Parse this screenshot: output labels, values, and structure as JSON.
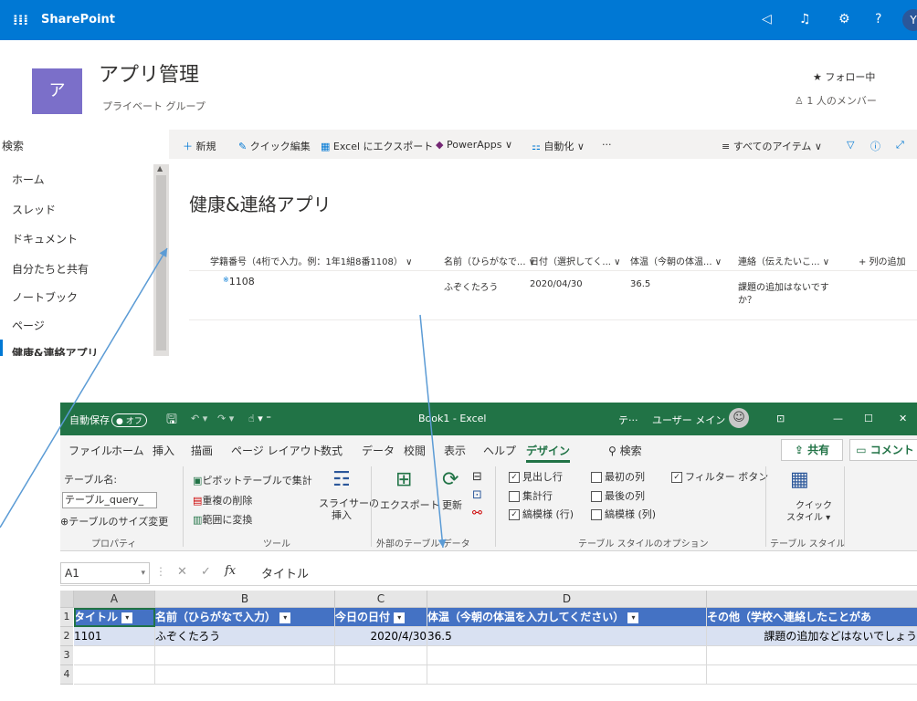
{
  "sharepoint": {
    "app_name": "SharePoint",
    "site_initial": "ア",
    "site_title": "アプリ管理",
    "site_subtitle": "プライベート グループ",
    "follow": "★ フォロー中",
    "members": "1 人のメンバー",
    "avatar_initial": "Y",
    "search_label": "検索",
    "nav": [
      "ホーム",
      "スレッド",
      "ドキュメント",
      "自分たちと共有",
      "ノートブック",
      "ページ",
      "健康&連絡アプリ"
    ],
    "commands": {
      "new": "新規",
      "quick_edit": "クイック編集",
      "export_excel": "Excel にエクスポート",
      "powerapps": "PowerApps",
      "automate": "自動化",
      "more": "···",
      "view": "すべてのアイテム"
    },
    "list_title": "健康&連絡アプリ",
    "columns": [
      "学籍番号（4桁で入力。例：1年1組8番1108）",
      "名前（ひらがなで...",
      "日付（選択してく...",
      "体温（今朝の体温...",
      "連絡（伝えたいこ...",
      "+ 列の追加"
    ],
    "row": {
      "id": "1108",
      "name": "ふぞくたろう",
      "date": "2020/04/30",
      "temp": "36.5",
      "contact_line1": "課題の追加はないです",
      "contact_line2": "か？"
    }
  },
  "excel": {
    "autosave": "自動保存",
    "autosave_state": "オフ",
    "title": "Book1  -  Excel",
    "tell": "テ···",
    "user": "ユーザー メイン",
    "tabs": [
      "ファイル",
      "ホーム",
      "挿入",
      "描画",
      "ページ レイアウト",
      "数式",
      "データ",
      "校閲",
      "表示",
      "ヘルプ",
      "デザイン"
    ],
    "search": "検索",
    "share": "共有",
    "comment": "コメント",
    "ribbon": {
      "table_name_label": "テーブル名:",
      "table_name_value": "テーブル_query_",
      "resize": "テーブルのサイズ変更",
      "group_properties": "プロパティ",
      "pivot": "ピボットテーブルで集計",
      "remove_dup": "重複の削除",
      "convert_range": "範囲に変換",
      "slicer_1": "スライサーの",
      "slicer_2": "挿入",
      "group_tools": "ツール",
      "export": "エクスポート",
      "refresh": "更新",
      "group_external": "外部のテーブル データ",
      "opt_header": "見出し行",
      "opt_total": "集計行",
      "opt_banded_rows": "縞模様 (行)",
      "opt_first_col": "最初の列",
      "opt_last_col": "最後の列",
      "opt_banded_cols": "縞模様 (列)",
      "opt_filter": "フィルター ボタン",
      "group_options": "テーブル スタイルのオプション",
      "quick_style_1": "クイック",
      "quick_style_2": "スタイル ▾",
      "group_style": "テーブル スタイル"
    },
    "name_box": "A1",
    "formula": "タイトル",
    "col_letters": [
      "A",
      "B",
      "C",
      "D"
    ],
    "row_numbers": [
      "1",
      "2",
      "3",
      "4"
    ],
    "headers": [
      "タイトル",
      "名前（ひらがなで入力）",
      "今日の日付",
      "体温（今朝の体温を入力してください）",
      "その他（学校へ連絡したことがあ"
    ],
    "row2": [
      "1101",
      "ふぞくたろう",
      "2020/4/30",
      "36.5",
      "課題の追加などはないでしょう"
    ]
  },
  "colors": {
    "sp_blue": "#0078d4",
    "excel_green": "#217346",
    "table_header": "#4472c4",
    "table_band": "#d9e1f2",
    "arrow": "#5b9bd5"
  }
}
